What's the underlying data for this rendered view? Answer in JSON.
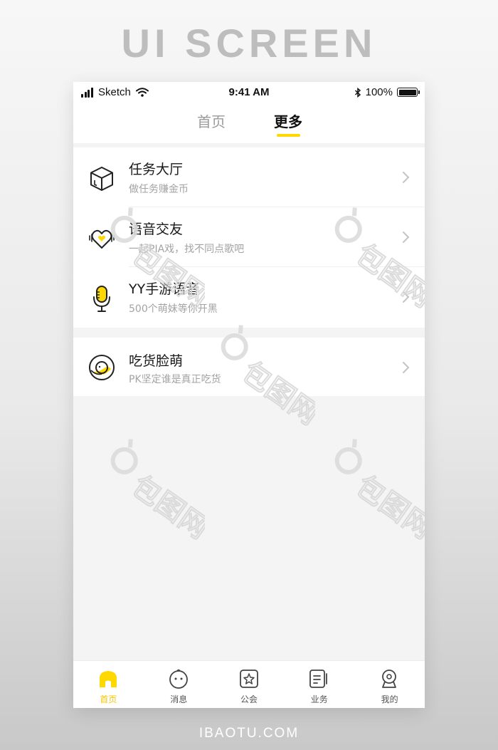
{
  "poster": {
    "heading": "UI SCREEN",
    "footer": "IBAOTU.COM"
  },
  "status_bar": {
    "carrier": "Sketch",
    "time": "9:41 AM",
    "battery": "100%"
  },
  "top_tabs": [
    {
      "label": "首页",
      "active": false
    },
    {
      "label": "更多",
      "active": true
    }
  ],
  "colors": {
    "accent": "#ffd800",
    "background": "#f4f4f4",
    "text": "#1a1a1a",
    "muted": "#a3a3a3"
  },
  "menu": [
    {
      "title": "任务大厅",
      "subtitle": "做任务赚金币",
      "icon": "box-icon"
    },
    {
      "title": "语音交友",
      "subtitle": "一起PIA戏，找不同点歌吧",
      "icon": "voice-heart-icon"
    },
    {
      "title": "YY手游语音",
      "subtitle": "500个萌妹等你开黑",
      "icon": "microphone-icon"
    },
    {
      "title": "吃货脸萌",
      "subtitle": "PK坚定谁是真正吃货",
      "icon": "food-plate-icon"
    }
  ],
  "bottom_tabs": [
    {
      "label": "首页",
      "icon": "home-icon",
      "active": true
    },
    {
      "label": "消息",
      "icon": "message-face-icon",
      "active": false
    },
    {
      "label": "公会",
      "icon": "guild-star-icon",
      "active": false
    },
    {
      "label": "业务",
      "icon": "business-icon",
      "active": false
    },
    {
      "label": "我的",
      "icon": "profile-icon",
      "active": false
    }
  ],
  "watermark": "包图网"
}
